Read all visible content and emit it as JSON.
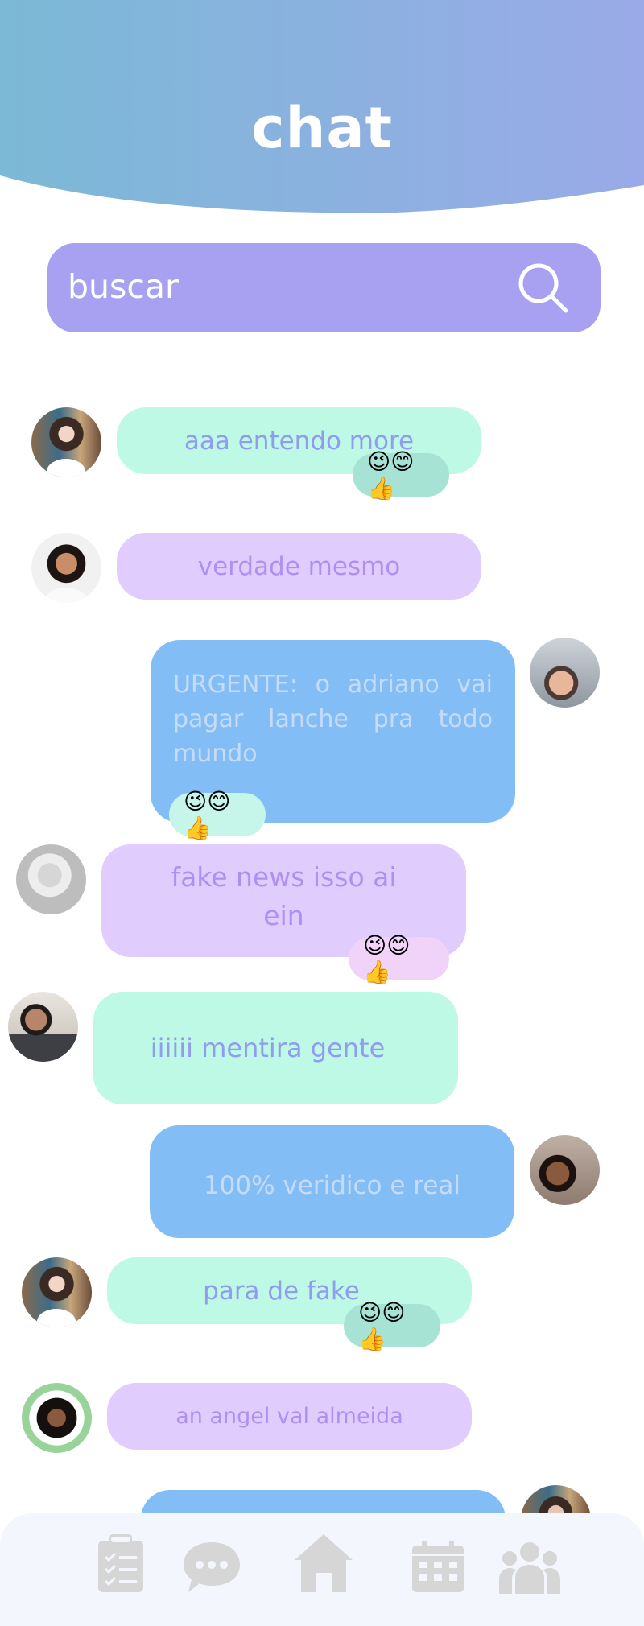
{
  "header": {
    "title": "chat"
  },
  "search": {
    "placeholder": "buscar",
    "icon": "search-icon"
  },
  "messages": [
    {
      "text": "aaa entendo more",
      "reactions": "😉😊👍",
      "style": "green",
      "side": "left"
    },
    {
      "text": "verdade mesmo",
      "reactions": "",
      "style": "purple",
      "side": "left"
    },
    {
      "text": "URGENTE: o adriano vai pagar lanche pra todo mundo",
      "reactions": "😉😊👍",
      "style": "blue",
      "side": "right"
    },
    {
      "text": "fake news isso ai ein",
      "reactions": "😉😊👍",
      "style": "purple",
      "side": "left"
    },
    {
      "text": "iiiiii mentira gente",
      "reactions": "",
      "style": "green",
      "side": "left"
    },
    {
      "text": "100% veridico e real",
      "reactions": "",
      "style": "blue",
      "side": "right"
    },
    {
      "text": "para de fake",
      "reactions": "😉😊👍",
      "style": "green",
      "side": "left"
    },
    {
      "text": "an angel val almeida",
      "reactions": "",
      "style": "purple",
      "side": "left"
    }
  ],
  "nav": {
    "items": [
      {
        "icon": "tasks-icon"
      },
      {
        "icon": "chat-icon"
      },
      {
        "icon": "home-icon"
      },
      {
        "icon": "calendar-icon"
      },
      {
        "icon": "group-icon"
      }
    ]
  },
  "colors": {
    "header_gradient_start": "#7bb9d6",
    "header_gradient_end": "#9aaae8",
    "search_bg": "#a8a0f0",
    "green_bubble": "#bef9e6",
    "purple_bubble": "#e0ccfd",
    "blue_bubble": "#82bef5",
    "nav_icon": "#d6d6d6"
  }
}
